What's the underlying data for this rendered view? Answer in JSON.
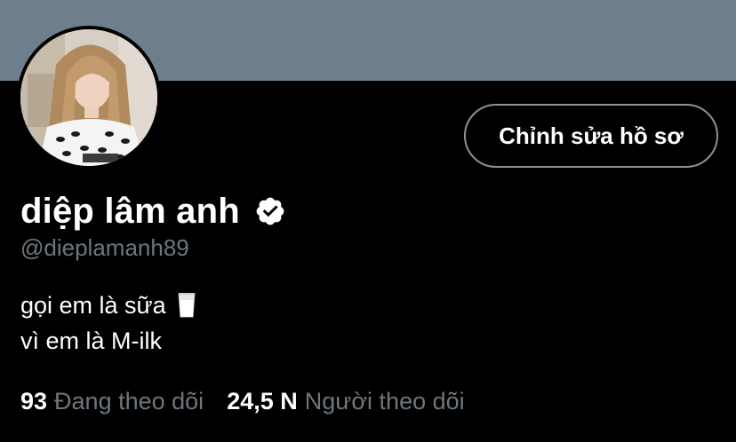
{
  "profile": {
    "display_name": "diệp lâm anh",
    "handle": "@dieplamanh89",
    "verified": true,
    "bio_line1": "gọi em là sữa",
    "bio_line1_emoji": "milk-glass-icon",
    "bio_line2": "vì em là M-ilk",
    "edit_button_label": "Chỉnh sửa hồ sơ"
  },
  "stats": {
    "following_count": "93",
    "following_label": "Đang theo dõi",
    "followers_count": "24,5 N",
    "followers_label": "Người theo dõi"
  },
  "colors": {
    "background": "#000000",
    "banner": "#6e7e8d",
    "secondary_text": "#6e767d",
    "button_border": "#8a9299",
    "primary_text": "#ffffff"
  }
}
